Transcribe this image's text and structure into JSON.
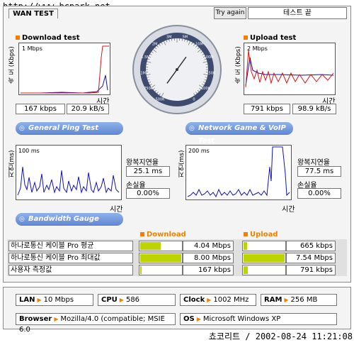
{
  "watermark": "http://www.bcpark.net",
  "title": "WAN TEST",
  "try_again": "Try again",
  "status": "테스트 끝",
  "download": {
    "title": "Download test",
    "ylabel": "속 도 (Kbps)",
    "scale": "1 Mbps",
    "xlabel": "시간",
    "kbps": "167 kbps",
    "kBs": "20.9 kB/s"
  },
  "upload": {
    "title": "Upload test",
    "ylabel": "속 도 (Kbps)",
    "scale": "2 Mbps",
    "xlabel": "시간",
    "kbps": "791 kbps",
    "kBs": "98.9 kB/s"
  },
  "gauge": {
    "ticks": [
      "500K",
      "750K",
      "1M",
      "1.5M",
      "2M",
      "3M",
      "5M",
      "10M",
      "100M",
      "250K",
      "100K",
      "0"
    ],
    "needle_fraction": 0.62
  },
  "general_ping": {
    "banner": "General Ping Test",
    "ylabel": "지연(ms)",
    "scale": "100 ms",
    "xlabel": "시간",
    "rtt_label": "왕복지연율",
    "rtt_value": "25.1 ms",
    "loss_label": "손실율",
    "loss_value": "0.00%"
  },
  "network_game": {
    "banner": "Network Game & VoIP Test",
    "ylabel": "지연(ms)",
    "scale": "200 ms",
    "xlabel": "시간",
    "rtt_label": "왕복지연율",
    "rtt_value": "77.5 ms",
    "loss_label": "손실율",
    "loss_value": "0.00%"
  },
  "bandwidth": {
    "banner": "Bandwidth Gauge",
    "download_header": "Download",
    "upload_header": "Upload",
    "colors": {
      "bar": "#bed400",
      "accent": "#f08000"
    },
    "rows": [
      {
        "name": "하나로통신 케이블 Pro 평균",
        "down_value": "4.04 Mbps",
        "down_fraction": 0.5,
        "up_value": "665 kbps",
        "up_fraction": 0.09
      },
      {
        "name": "하나로통신 케이블 Pro 최대값",
        "down_value": "8.00 Mbps",
        "down_fraction": 1.0,
        "up_value": "7.54 Mbps",
        "up_fraction": 1.0
      },
      {
        "name": "사용자 측정값",
        "down_value": "167 kbps",
        "down_fraction": 0.02,
        "up_value": "791 kbps",
        "up_fraction": 0.1
      }
    ]
  },
  "system": {
    "lan_label": "LAN",
    "lan_value": "10 Mbps",
    "cpu_label": "CPU",
    "cpu_value": "586",
    "clock_label": "Clock",
    "clock_value": "1002 MHz",
    "ram_label": "RAM",
    "ram_value": "256 MB",
    "browser_label": "Browser",
    "browser_value": "Mozilla/4.0 (compatible; MSIE 6.0",
    "os_label": "OS",
    "os_value": "Microsoft Windows XP"
  },
  "footer": "쵸코리트 / 2002-08-24 11:21:08"
}
